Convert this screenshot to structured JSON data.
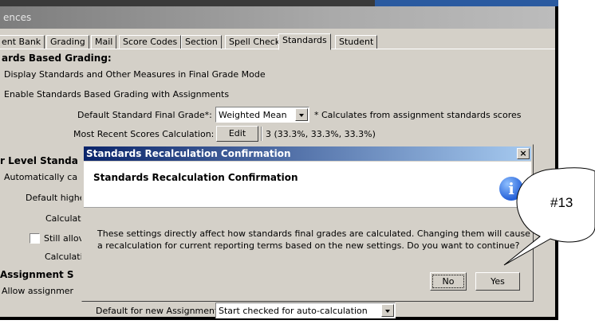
{
  "window": {
    "title": "ences"
  },
  "tabs": [
    "ent Bank",
    "Grading",
    "Mail",
    "Score Codes",
    "Section",
    "Spell Check",
    "Standards",
    "Student"
  ],
  "active_tab": "Standards",
  "section1": {
    "heading": "ards Based Grading:",
    "opt1": "Display Standards and Other Measures in Final Grade Mode",
    "opt2": "Enable Standards Based Grading with Assignments",
    "default_final_label": "Default Standard Final Grade*:",
    "default_final_value": "Weighted Mean",
    "default_final_note": "* Calculates from assignment standards scores",
    "recent_label": "Most Recent Scores Calculation:",
    "edit_label": "Edit",
    "recent_value": "3 (33.3%, 33.3%, 33.3%)"
  },
  "section2": {
    "heading": "r Level Standa",
    "auto": "Automatically ca",
    "default_high": "Default highe",
    "calc1": "Calculat",
    "still": "Still allov",
    "calc2": "Calculati"
  },
  "section3": {
    "heading": "Assignment S",
    "allow": "Allow assignmer",
    "default_new_label": "Default for new Assignments:",
    "default_new_value": "Start checked for auto-calculation"
  },
  "dialog": {
    "title": "Standards Recalculation Confirmation",
    "heading": "Standards Recalculation Confirmation",
    "message_line1": "These settings directly affect how standards final grades are calculated. Changing them will cause",
    "message_line2": "a recalculation for current reporting terms based on the new settings. Do you want to continue?",
    "no_label": "No",
    "yes_label": "Yes",
    "close_glyph": "×",
    "info_glyph": "i"
  },
  "callout": {
    "label": "#13"
  }
}
